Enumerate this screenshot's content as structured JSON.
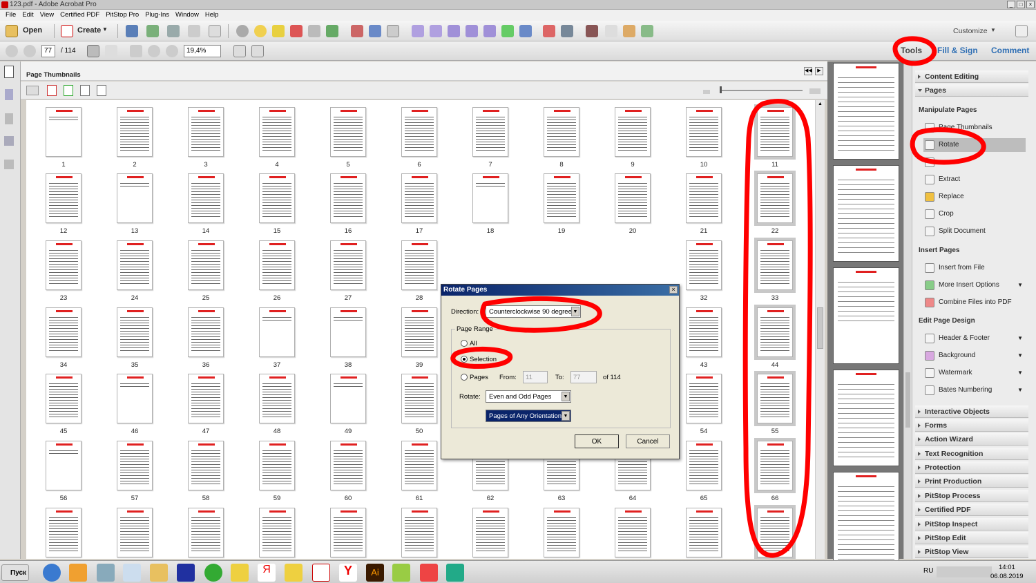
{
  "window": {
    "title": "123.pdf - Adobe Acrobat Pro"
  },
  "menu": [
    "File",
    "Edit",
    "View",
    "Certified PDF",
    "PitStop Pro",
    "Plug-Ins",
    "Window",
    "Help"
  ],
  "toolbar": {
    "open_label": "Open",
    "create_label": "Create",
    "customize_label": "Customize"
  },
  "nav": {
    "current_page": "77",
    "total_pages": "/ 114",
    "zoom": "19,4%"
  },
  "task_tabs": {
    "tools": "Tools",
    "fill_sign": "Fill & Sign",
    "comment": "Comment"
  },
  "panel": {
    "title": "Page Thumbnails"
  },
  "thumbnails": {
    "rows": [
      [
        "1",
        "2",
        "3",
        "4",
        "5",
        "6",
        "7",
        "8",
        "9",
        "10",
        "11"
      ],
      [
        "12",
        "13",
        "14",
        "15",
        "16",
        "17",
        "18",
        "19",
        "20",
        "21",
        "22"
      ],
      [
        "23",
        "24",
        "25",
        "26",
        "27",
        "28",
        "",
        "",
        "",
        "32",
        "33"
      ],
      [
        "34",
        "35",
        "36",
        "37",
        "38",
        "39",
        "",
        "",
        "",
        "43",
        "44"
      ],
      [
        "45",
        "46",
        "47",
        "48",
        "49",
        "50",
        "",
        "",
        "",
        "54",
        "55"
      ],
      [
        "56",
        "57",
        "58",
        "59",
        "60",
        "61",
        "62",
        "63",
        "64",
        "65",
        "66"
      ],
      [
        "",
        "",
        "",
        "",
        "",
        "",
        "",
        "",
        "",
        "",
        ""
      ]
    ]
  },
  "right_panel": {
    "sections": {
      "content_editing": "Content Editing",
      "pages": "Pages",
      "interactive": "Interactive Objects",
      "forms": "Forms",
      "action_wizard": "Action Wizard",
      "text_recognition": "Text Recognition",
      "protection": "Protection",
      "print_production": "Print Production",
      "pitstop_process": "PitStop Process",
      "certified_pdf": "Certified PDF",
      "pitstop_inspect": "PitStop Inspect",
      "pitstop_edit": "PitStop Edit",
      "pitstop_view": "PitStop View"
    },
    "manipulate_pages": "Manipulate Pages",
    "manipulate_items": [
      "Page Thumbnails",
      "Rotate",
      "",
      "Extract",
      "Replace",
      "Crop",
      "Split Document"
    ],
    "insert_pages": "Insert Pages",
    "insert_items": [
      "Insert from File",
      "More Insert Options",
      "Combine Files into PDF"
    ],
    "edit_page_design": "Edit Page Design",
    "design_items": [
      "Header & Footer",
      "Background",
      "Watermark",
      "Bates Numbering"
    ]
  },
  "dialog": {
    "title": "Rotate Pages",
    "direction_label": "Direction:",
    "direction_value": "Counterclockwise 90 degrees",
    "page_range_label": "Page Range",
    "all_label": "All",
    "selection_label": "Selection",
    "pages_label": "Pages",
    "from_label": "From:",
    "from_value": "11",
    "to_label": "To:",
    "to_value": "77",
    "of_label": "of 114",
    "rotate_label": "Rotate:",
    "rotate_value": "Even and Odd Pages",
    "orientation_value": "Pages of Any Orientation",
    "ok_label": "OK",
    "cancel_label": "Cancel"
  },
  "taskbar": {
    "start_label": "Пуск",
    "lang": "RU",
    "time": "14:01",
    "date": "06.08.2019"
  },
  "colors": {
    "annotation_red": "#ff0000",
    "dialog_title": "#0a246a",
    "tab_blue": "#2f6fb4"
  }
}
